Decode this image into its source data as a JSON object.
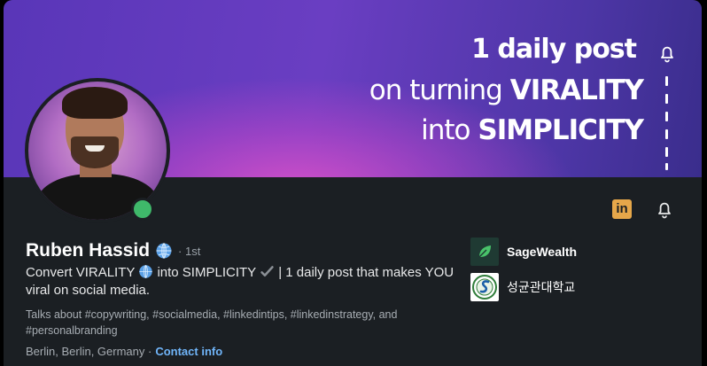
{
  "banner": {
    "line1": "1 daily post",
    "line2_pre": "on turning ",
    "line2_bold": "VIRALITY",
    "line3_pre": "into ",
    "line3_bold": "SIMPLICITY",
    "icons": [
      "bell-icon"
    ]
  },
  "profile": {
    "name": "Ruben Hassid",
    "degree": "· 1st",
    "headline_part1": "Convert VIRALITY ",
    "headline_part2": " into SIMPLICITY ",
    "headline_part3": " | 1 daily post that makes YOU viral on social media.",
    "talks_about": "Talks about #copywriting, #socialmedia, #linkedintips, #linkedinstrategy, and #personalbranding",
    "location": "Berlin, Berlin, Germany ·",
    "contact_info": "Contact info",
    "status": "online"
  },
  "actions": {
    "linkedin_label": "in",
    "icons": [
      "linkedin-icon",
      "bell-icon"
    ]
  },
  "companies": [
    {
      "name": "SageWealth",
      "logo": "sagewealth-logo"
    },
    {
      "name": "성균관대학교",
      "logo": "skku-logo"
    }
  ],
  "colors": {
    "background": "#1b1f23",
    "link": "#70b5f9",
    "online": "#3fb86a",
    "linkedin_icon": "#e6a74a"
  }
}
